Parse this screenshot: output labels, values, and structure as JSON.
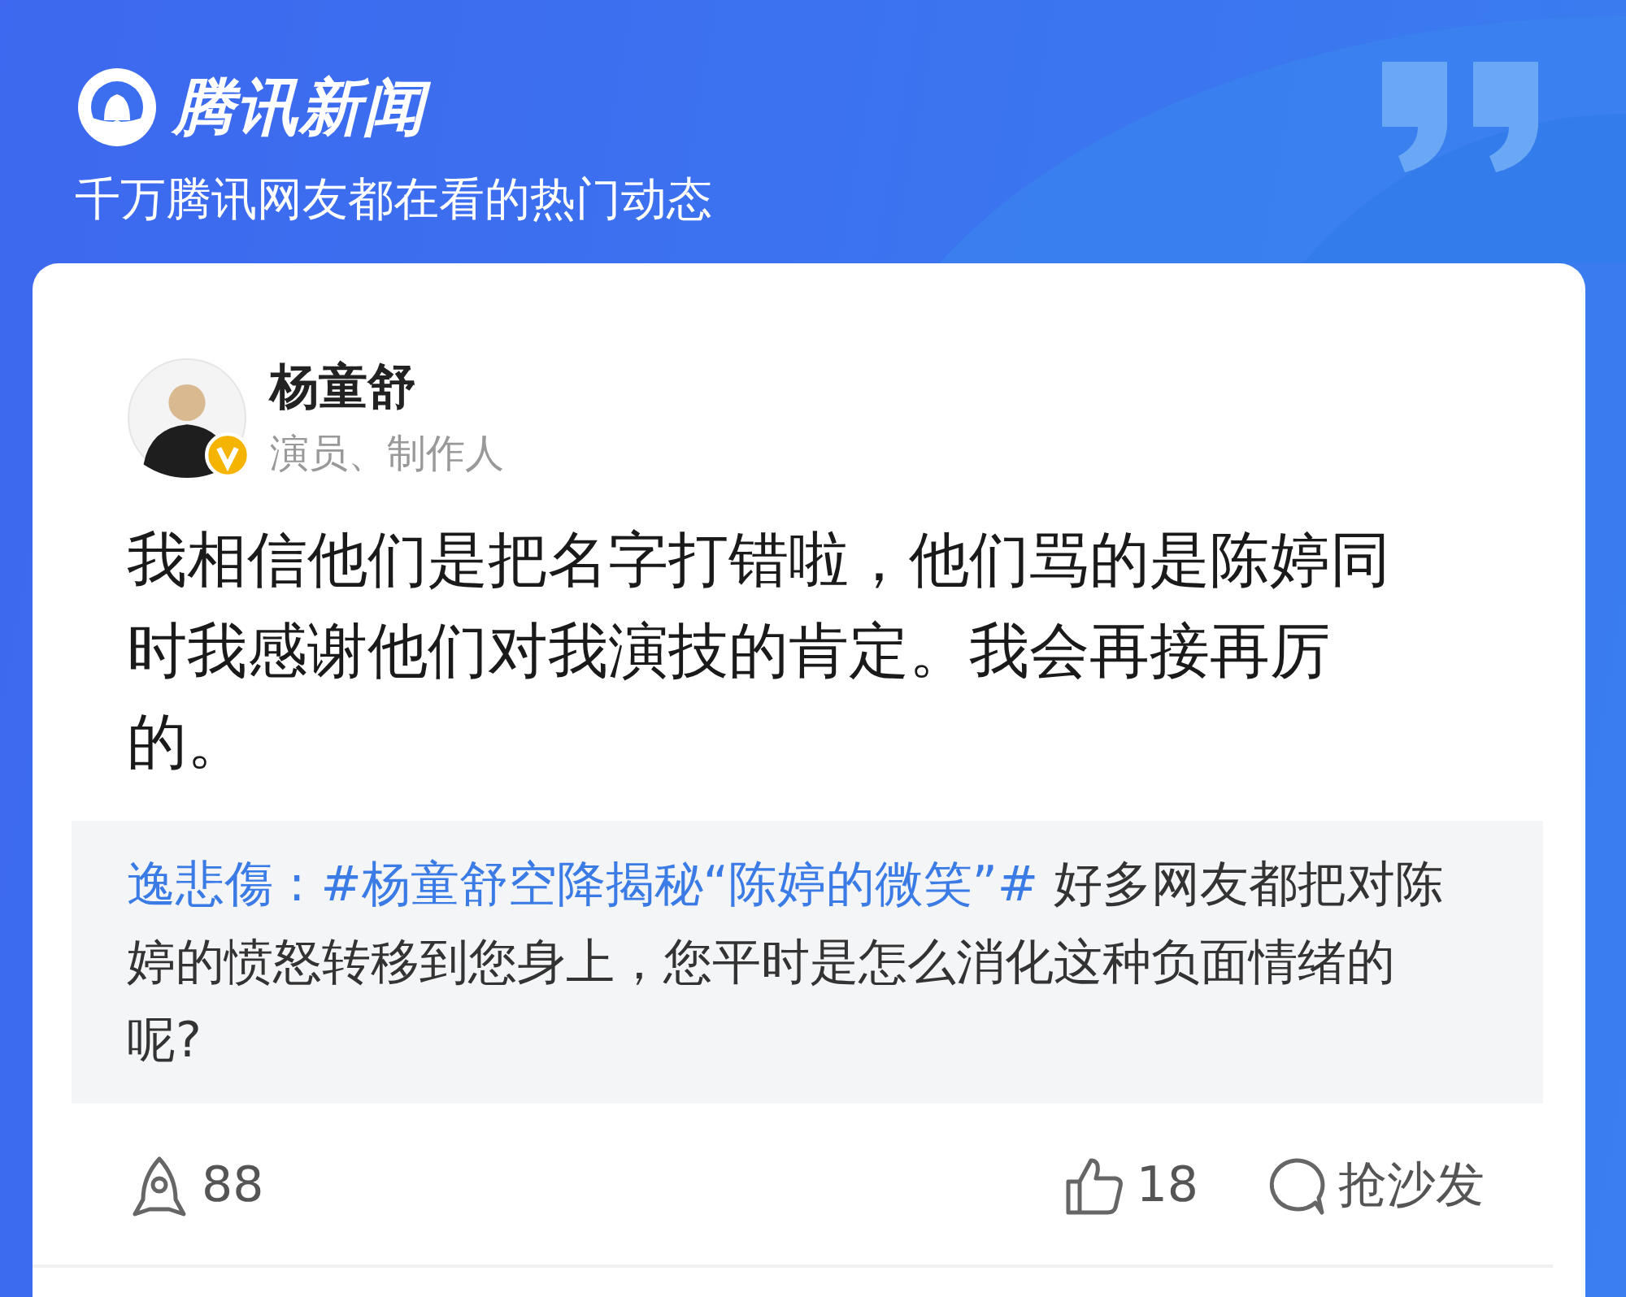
{
  "header": {
    "logo_text": "腾讯新闻",
    "tagline": "千万腾讯网友都在看的热门动态"
  },
  "post": {
    "author": {
      "name": "杨童舒",
      "title": "演员、制作人",
      "verified": true
    },
    "text": "我相信他们是把名字打错啦，他们骂的是陈婷同时我感谢他们对我演技的肯定。我会再接再厉的。",
    "quote": {
      "author": "逸悲傷 : ",
      "hashtag": "#杨童舒空降揭秘“陈婷的微笑”#",
      "text": " 好多网友都把对陈婷的愤怒转移到您身上，您平时是怎么消化这种负面情绪的呢?"
    }
  },
  "footer": {
    "shares": "88",
    "likes": "18",
    "comment_label": "抢沙发"
  }
}
